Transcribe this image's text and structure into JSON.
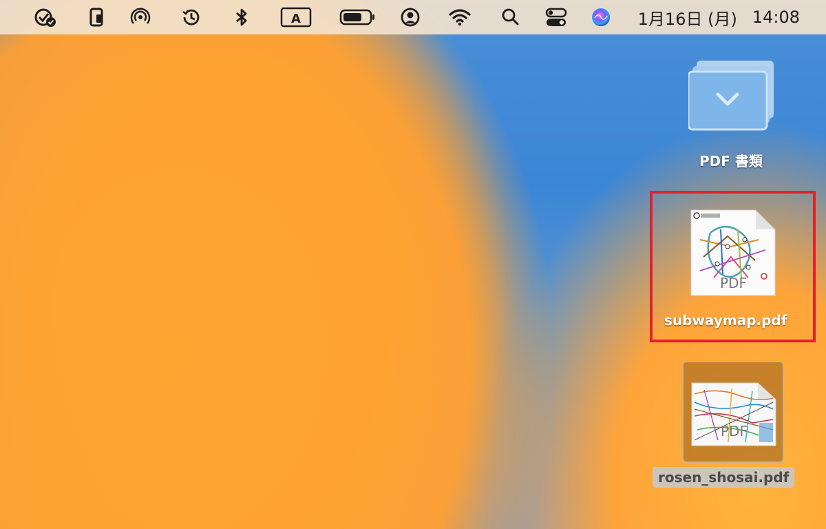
{
  "menubar": {
    "icons": [
      "task-check-icon",
      "handoff-device-icon",
      "airdrop-icon",
      "time-machine-icon",
      "bluetooth-icon",
      "input-source-icon",
      "battery-icon",
      "user-account-icon",
      "wifi-icon",
      "spotlight-search-icon",
      "control-center-icon",
      "siri-icon"
    ],
    "input_source_letter": "A",
    "date": "1月16日 (月)",
    "time": "14:08"
  },
  "desktop": {
    "items": [
      {
        "name": "PDF 書類",
        "kind": "stack-folder"
      },
      {
        "name": "subwaymap.pdf",
        "kind": "pdf-file",
        "badge": "PDF"
      },
      {
        "name": "rosen_shosai.pdf",
        "kind": "pdf-file",
        "badge": "PDF",
        "selected": true
      }
    ]
  },
  "colors": {
    "highlight_border": "#e4202c",
    "menubar_bg": "#f2e2cd",
    "folder_blue": "#7fb6ea"
  }
}
